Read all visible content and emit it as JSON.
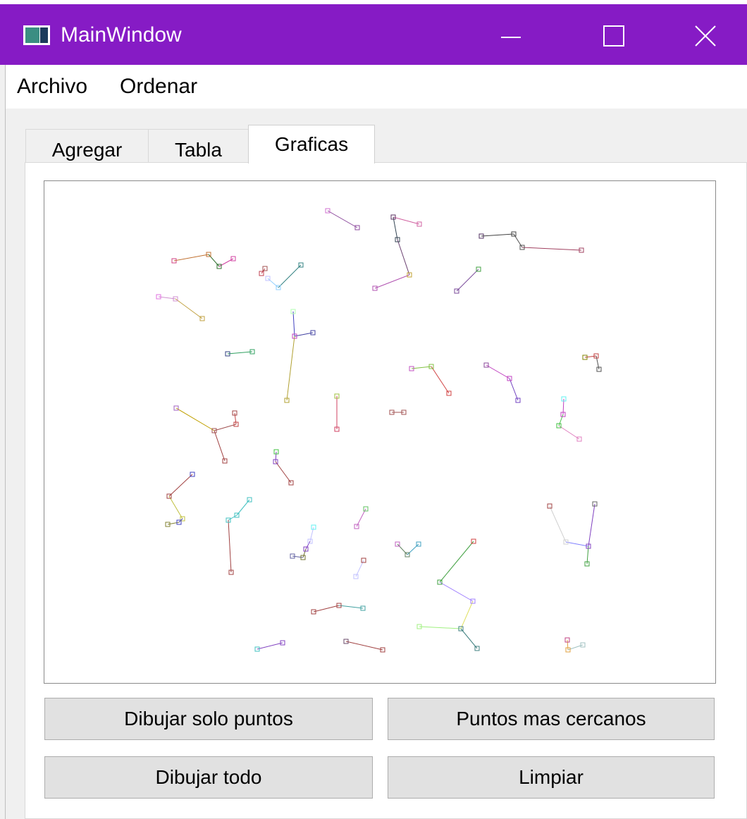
{
  "window": {
    "title": "MainWindow",
    "titlebar_color": "#861bc5",
    "icons": [
      "app-icon",
      "minimize-icon",
      "maximize-icon",
      "close-icon"
    ]
  },
  "menubar": {
    "items": [
      {
        "label": "Archivo"
      },
      {
        "label": "Ordenar"
      }
    ]
  },
  "tabs": [
    {
      "label": "Agregar",
      "active": false
    },
    {
      "label": "Tabla",
      "active": false
    },
    {
      "label": "Graficas",
      "active": true
    }
  ],
  "buttons": {
    "draw_points": "Dibujar solo puntos",
    "closest_points": "Puntos mas cercanos",
    "draw_all": "Dibujar todo",
    "clear": "Limpiar"
  }
}
